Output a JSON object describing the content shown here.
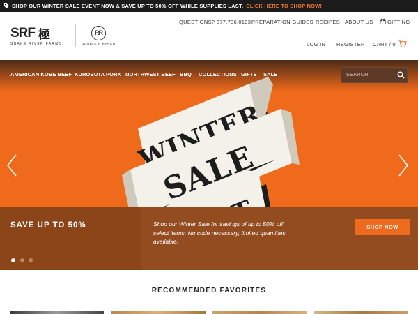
{
  "promo_bar": {
    "icon": "tag-icon",
    "message": "SHOP OUR WINTER SALE EVENT NOW & SAVE UP TO 50% OFF WHILE SUPPLIES LAST.",
    "link": "CLICK HERE TO SHOP NOW!"
  },
  "header": {
    "logo_srf": "SRF",
    "logo_kanji": "極",
    "logo_sub": "SNAKE RIVER FARMS.",
    "rr_mark": "RR",
    "rr_text": "DOUBLE R RANCH",
    "top_links": [
      "QUESTIONS? 877.736.0193",
      "PREPARATION GUIDES",
      "RECIPES",
      "ABOUT US",
      "GIFTING"
    ],
    "account_links": [
      "LOG IN",
      "REGISTER",
      "CART / 0"
    ]
  },
  "nav": {
    "items": [
      "AMERICAN KOBE BEEF",
      "KUROBUTA PORK",
      "NORTHWEST BEEF",
      "BBQ",
      "COLLECTIONS",
      "GIFTS",
      "SALE"
    ],
    "search_placeholder": "SEARCH"
  },
  "hero": {
    "banner_lines": [
      "WINTER",
      "SALE",
      "EVENT"
    ],
    "save_text": "SAVE UP TO 50%",
    "description": "Shop our Winter Sale for savings of up to 50% off select items. No code necessary, limited quantities available.",
    "cta": "SHOP NOW",
    "slides_total": 3,
    "active_slide": 1
  },
  "recommended": {
    "title": "RECOMMENDED FAVORITES"
  },
  "colors": {
    "accent": "#f07a2a",
    "hero_orange": "#f06a1c",
    "band_brown": "#934c20",
    "promo_bg": "#1b1b1b"
  }
}
